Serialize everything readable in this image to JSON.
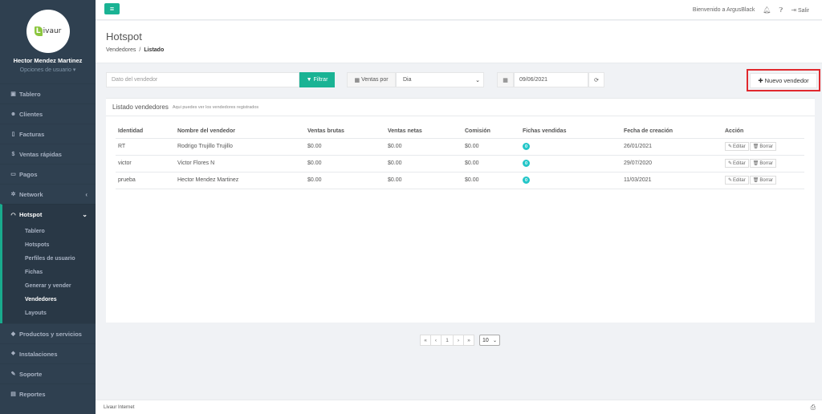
{
  "profile": {
    "logo_letter": "L",
    "logo_text": "ivaur",
    "name": "Hector Mendez Martinez",
    "options": "Opciones de usuario"
  },
  "sidebar": {
    "items": [
      {
        "label": "Tablero",
        "icon": "dashboard-icon"
      },
      {
        "label": "Clientes",
        "icon": "users-icon"
      },
      {
        "label": "Facturas",
        "icon": "file-icon"
      },
      {
        "label": "Ventas rápidas",
        "icon": "dollar-icon"
      },
      {
        "label": "Pagos",
        "icon": "money-icon"
      },
      {
        "label": "Network",
        "icon": "sitemap-icon"
      },
      {
        "label": "Hotspot",
        "icon": "wifi-icon"
      },
      {
        "label": "Productos y servicios",
        "icon": "tag-icon"
      },
      {
        "label": "Instalaciones",
        "icon": "wrench-icon"
      },
      {
        "label": "Soporte",
        "icon": "support-icon"
      },
      {
        "label": "Reportes",
        "icon": "chart-icon"
      }
    ],
    "hotspot_sub": [
      "Tablero",
      "Hotspots",
      "Perfiles de usuario",
      "Fichas",
      "Generar y vender",
      "Vendedores",
      "Layouts"
    ]
  },
  "topbar": {
    "welcome": "Bienvenido a ArgusBlack",
    "logout": "Salir"
  },
  "heading": {
    "title": "Hotspot",
    "breadcrumb_parent": "Vendedores",
    "breadcrumb_current": "Listado"
  },
  "filters": {
    "search_placeholder": "Dato del vendedor",
    "filter_button": "Filtrar",
    "ventas_label": "Ventas por",
    "period_value": "Dia",
    "date_value": "09/06/2021",
    "new_button": "Nuevo vendedor"
  },
  "panel": {
    "title": "Listado vendedores",
    "subtitle": "Aqui puedes ver los vendedores registrados"
  },
  "table": {
    "headers": [
      "Identidad",
      "Nombre del vendedor",
      "Ventas brutas",
      "Ventas netas",
      "Comisión",
      "Fichas vendidas",
      "Fecha de creación",
      "Acción"
    ],
    "rows": [
      {
        "id": "RT",
        "name": "Rodrigo Trujillo Trujillo",
        "bruto": "$0.00",
        "neto": "$0.00",
        "comision": "$0.00",
        "fichas": "0",
        "fecha": "26/01/2021"
      },
      {
        "id": "victor",
        "name": "Victor Flores N",
        "bruto": "$0.00",
        "neto": "$0.00",
        "comision": "$0.00",
        "fichas": "0",
        "fecha": "29/07/2020"
      },
      {
        "id": "prueba",
        "name": "Hector Mendez Martinez",
        "bruto": "$0.00",
        "neto": "$0.00",
        "comision": "$0.00",
        "fichas": "0",
        "fecha": "11/03/2021"
      }
    ],
    "edit_label": "Editar",
    "delete_label": "Borrar"
  },
  "pagination": {
    "first": "«",
    "prev": "‹",
    "page": "1",
    "next": "›",
    "last": "»",
    "page_size": "10"
  },
  "footer": {
    "text": "Livaur Internet"
  },
  "colors": {
    "sidebar_bg": "#2f4050",
    "accent": "#1ab394",
    "badge": "#23c6c8",
    "highlight_border": "#e0282d"
  }
}
